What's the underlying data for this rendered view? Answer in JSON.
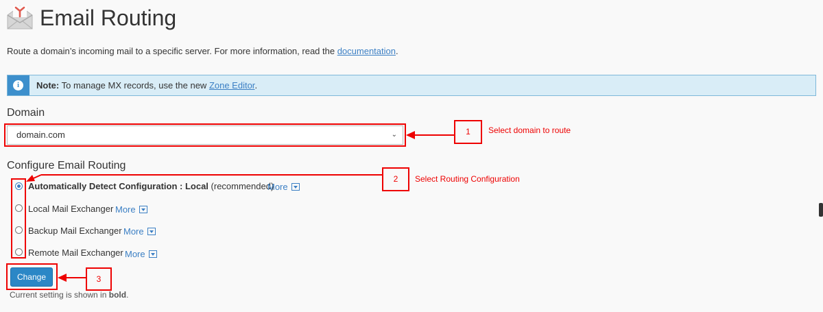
{
  "page": {
    "title": "Email Routing",
    "description_prefix": "Route a domain’s incoming mail to a specific server. For more information, read the ",
    "description_link": "documentation",
    "description_suffix": "."
  },
  "note": {
    "label": "Note:",
    "text_prefix": " To manage MX records, use the new ",
    "link": "Zone Editor",
    "text_suffix": "."
  },
  "domain": {
    "heading": "Domain",
    "selected": "domain.com"
  },
  "routing": {
    "heading": "Configure Email Routing",
    "options": [
      {
        "label": "Automatically Detect Configuration : Local",
        "suffix": " (recommended)",
        "more": "More",
        "checked": true
      },
      {
        "label": "Local Mail Exchanger",
        "suffix": "",
        "more": "More",
        "checked": false
      },
      {
        "label": "Backup Mail Exchanger",
        "suffix": "",
        "more": "More",
        "checked": false
      },
      {
        "label": "Remote Mail Exchanger",
        "suffix": "",
        "more": "More",
        "checked": false
      }
    ]
  },
  "actions": {
    "change_label": "Change",
    "current_prefix": "Current setting is shown in ",
    "current_bold": "bold",
    "current_suffix": "."
  },
  "annotations": {
    "step1": {
      "number": "1",
      "text": "Select domain to route"
    },
    "step2": {
      "number": "2",
      "text": "Select Routing Configuration"
    },
    "step3": {
      "number": "3"
    }
  },
  "colors": {
    "accent": "#3b7fc4",
    "button": "#2b87c6",
    "note_bg": "#d9edf7",
    "annotation": "#ee0000"
  }
}
